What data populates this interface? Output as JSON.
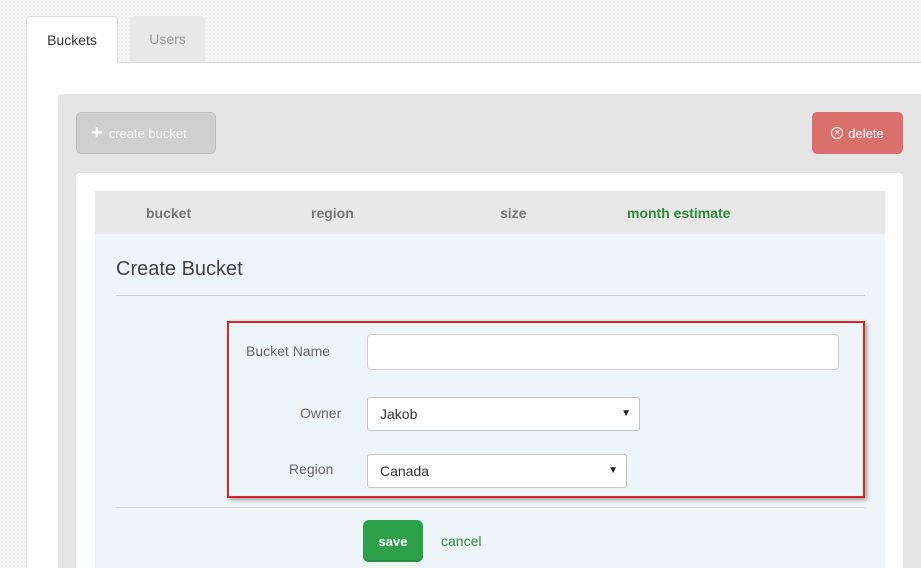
{
  "tabs": [
    {
      "label": "Buckets",
      "active": true
    },
    {
      "label": "Users",
      "active": false
    }
  ],
  "toolbar": {
    "create_label": "create bucket",
    "delete_label": "delete"
  },
  "table": {
    "columns": [
      "bucket",
      "region",
      "size",
      "month estimate"
    ]
  },
  "form": {
    "title": "Create Bucket",
    "fields": {
      "bucket_name": {
        "label": "Bucket Name",
        "value": "",
        "placeholder": ""
      },
      "owner": {
        "label": "Owner",
        "selected": "Jakob"
      },
      "region": {
        "label": "Region",
        "selected": "Canada"
      }
    },
    "save_label": "save",
    "cancel_label": "cancel"
  },
  "colors": {
    "accent_green": "#2ea04a",
    "link_green": "#2e8b3e",
    "delete_red": "#d9706e",
    "highlight_red": "#d9262b"
  },
  "icons": {
    "create": "plus-icon",
    "delete": "circle-x-icon",
    "dropdown": "caret-down-icon"
  }
}
